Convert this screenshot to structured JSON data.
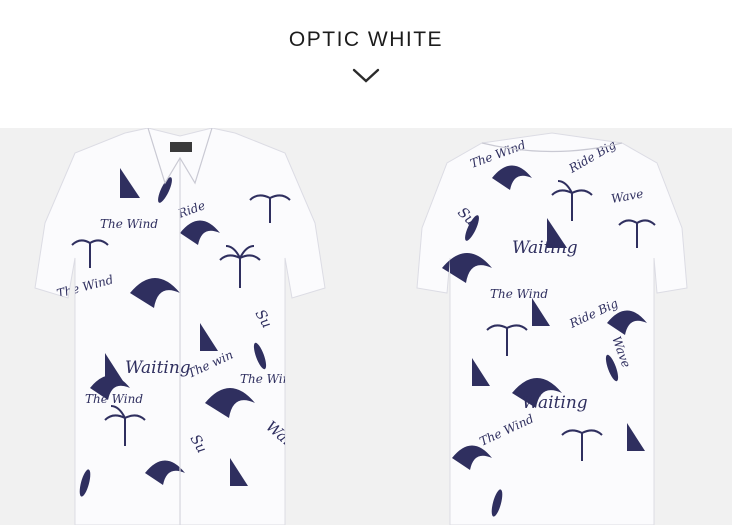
{
  "header": {
    "title": "OPTIC WHITE",
    "chevron_icon": "chevron-down-icon"
  },
  "colors": {
    "background": "#ffffff",
    "photo_band": "#f1f1f1",
    "shirt": "#fbfbfd",
    "print": "#2f2f5f"
  },
  "products": [
    {
      "view": "front",
      "print_words": [
        "The Wind",
        "Ride",
        "Waiting",
        "Su",
        "The win"
      ]
    },
    {
      "view": "back",
      "print_words": [
        "The Wind",
        "Ride Big",
        "Waiting",
        "Wave",
        "Su"
      ]
    }
  ]
}
